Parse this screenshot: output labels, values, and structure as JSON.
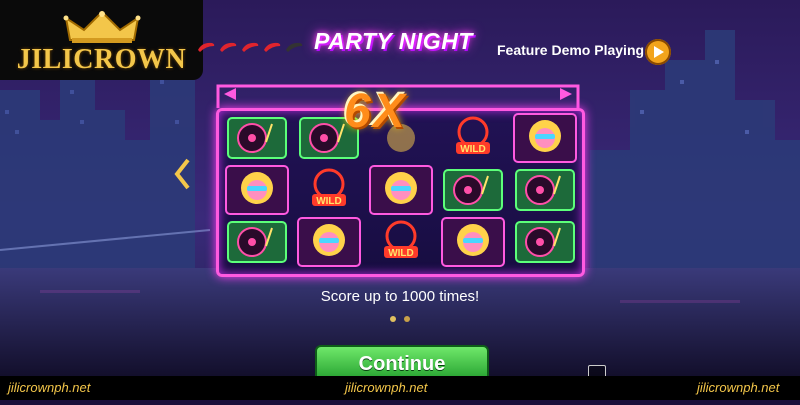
{
  "logo": {
    "text": "JILICROWN"
  },
  "header": {
    "title": "PARTY NIGHT",
    "demo_label": "Feature Demo Playing"
  },
  "chilis": {
    "count": 5,
    "colors": [
      "#e0242d",
      "#e0242d",
      "#e0242d",
      "#e0242d",
      "#333333"
    ]
  },
  "board": {
    "multiplier": "6X",
    "rows": [
      [
        "turntable-icon",
        "turntable-icon",
        "multiplier-banner",
        "wild-dj-icon",
        "party-girl-icon"
      ],
      [
        "party-girl-icon",
        "wild-dj-icon",
        "party-girl-icon",
        "turntable-icon",
        "turntable-icon"
      ],
      [
        "turntable-icon",
        "party-girl-icon",
        "wild-dj-icon",
        "party-girl-icon",
        "turntable-icon"
      ]
    ],
    "wild_label": "WILD"
  },
  "caption": "Score up to 1000 times!",
  "pagination": {
    "count": 2,
    "active": 1
  },
  "continue_label": "Continue",
  "footer": {
    "left": "jilicrownph.net",
    "center": "jilicrownph.net",
    "right": "jilicrownph.net"
  },
  "colors": {
    "neon_pink": "#ff3df5",
    "gold": "#f3c64a",
    "continue_green": "#1e9a2a"
  }
}
